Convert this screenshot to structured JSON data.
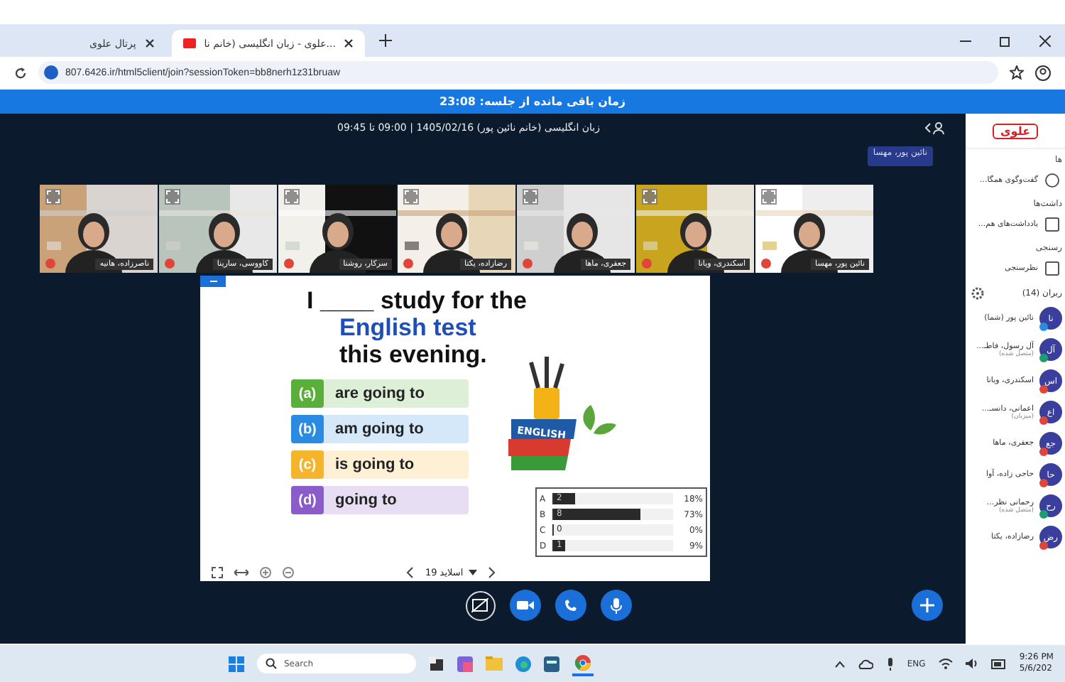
{
  "browser": {
    "tabs": [
      {
        "title": "علوی - زبان انگلیسی (خانم نا...",
        "selected": true
      },
      {
        "title": "پرتال علوی",
        "selected": false
      }
    ],
    "url": "807.6426.ir/html5client/join?sessionToken=bb8nerh1z31bruaw"
  },
  "session": {
    "remaining": "زمان باقی مانده از جلسه: 23:08",
    "title": "زبان انگلیسی (خانم نائین پور) 1405/02/16 | 09:00 تا 09:45",
    "presenter": "نائین پور، مهسا"
  },
  "videos": [
    {
      "name": "نائین پور، مهسا"
    },
    {
      "name": "اسکندری، ویانا"
    },
    {
      "name": "جعفری، ماها"
    },
    {
      "name": "رضازاده، یکتا"
    },
    {
      "name": "سرکار، روشنا"
    },
    {
      "name": "کاووسی، سارینا"
    },
    {
      "name": "ناصرزاده، هانیه"
    }
  ],
  "slide": {
    "line_1": "I ____ study for the",
    "line_2": "English test",
    "line_3": "this evening.",
    "options": [
      {
        "letter": "(a)",
        "text": "are going to",
        "color": "#5aaf3a"
      },
      {
        "letter": "(b)",
        "text": "am going to",
        "color": "#2b8be0"
      },
      {
        "letter": "(c)",
        "text": "is going to",
        "color": "#f4b52c"
      },
      {
        "letter": "(d)",
        "text": "going to",
        "color": "#8a5bc9"
      }
    ],
    "book_label": "ENGLISH",
    "poll": [
      {
        "label": "A",
        "count": "2",
        "percent": "18%",
        "level": 0.18
      },
      {
        "label": "B",
        "count": "8",
        "percent": "73%",
        "level": 0.73
      },
      {
        "label": "C",
        "count": "0",
        "percent": "0%",
        "level": 0
      },
      {
        "label": "D",
        "count": "1",
        "percent": "9%",
        "level": 0.09
      }
    ],
    "page_label": "اسلاید 19"
  },
  "sidebar": {
    "logo": "علوی",
    "sections": [
      {
        "heading": "ها",
        "item": "گفت‌وگوی همگا..."
      },
      {
        "heading": "داشت‌ها",
        "item": "یادداشت‌های هم..."
      },
      {
        "heading": "رسنجی",
        "item": "نظرسنجی"
      }
    ],
    "users_heading": "ربران (14)",
    "users": [
      {
        "initials": "نا",
        "name": "نائین پور (شما)",
        "color": "#2a8ce0"
      },
      {
        "initials": "آل",
        "name": "آل رسول، فاطـ...",
        "sub": "(متصل شده)",
        "color": "#1c9e6e"
      },
      {
        "initials": "اس",
        "name": "اسکندری، ویانا",
        "color": "#e0453a"
      },
      {
        "initials": "اع",
        "name": "اعمانی، دانسـ...",
        "sub": "(میزبان)",
        "color": "#e0453a"
      },
      {
        "initials": "جع",
        "name": "جعفری، ماها",
        "color": "#e0453a"
      },
      {
        "initials": "حا",
        "name": "حاجی زاده، آوا",
        "color": "#e0453a"
      },
      {
        "initials": "رح",
        "name": "رحمانی نظر...",
        "sub": "(متصل شده)",
        "color": "#1c9e6e"
      },
      {
        "initials": "رض",
        "name": "رضازاده، یکتا",
        "color": "#e0453a"
      }
    ]
  },
  "taskbar": {
    "search": "Search",
    "language": "ENG",
    "time": "9:26 PM",
    "date": "5/6/202"
  }
}
